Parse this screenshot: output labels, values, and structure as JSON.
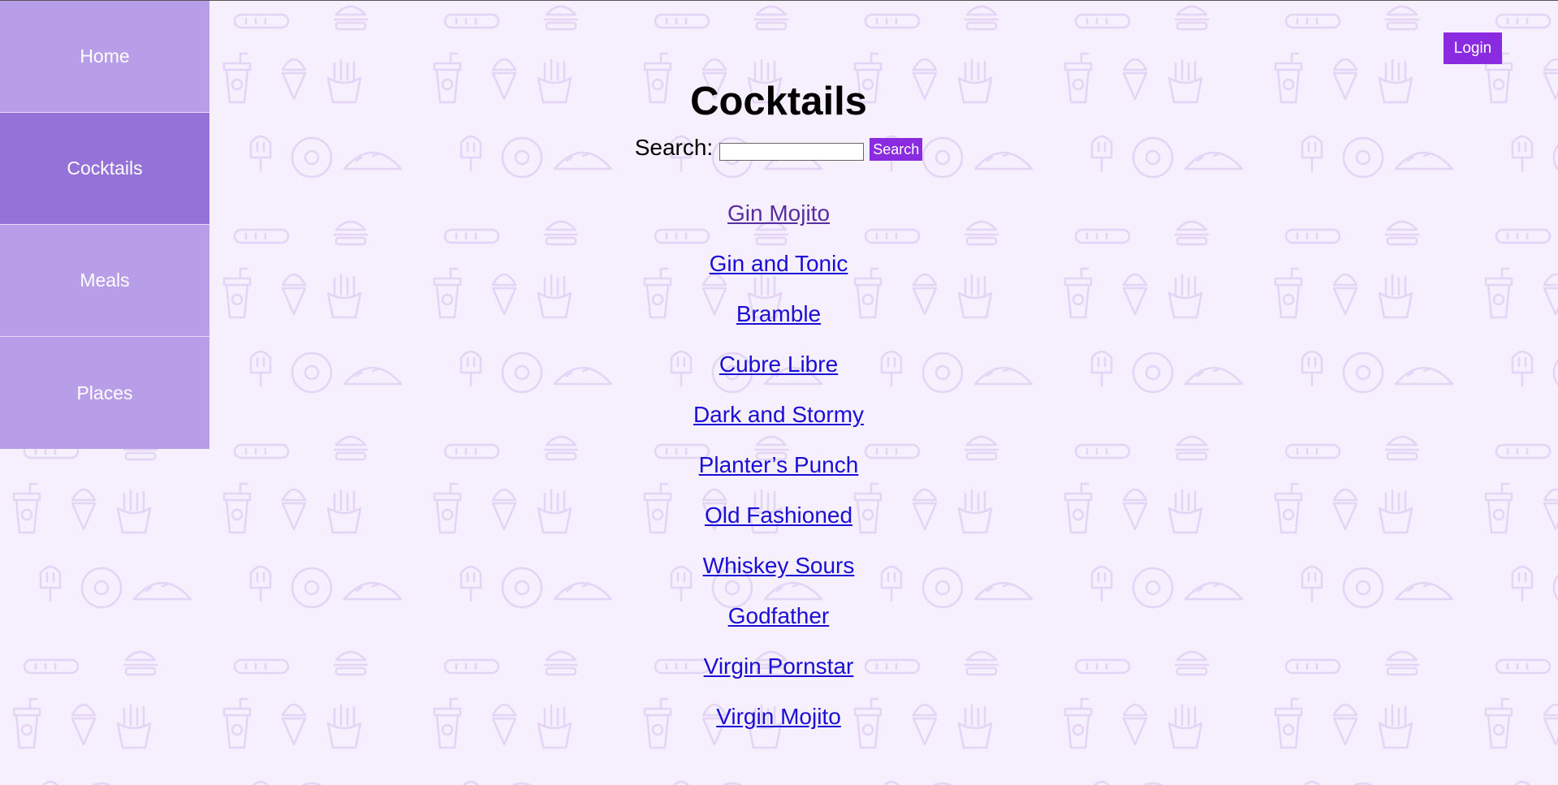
{
  "sidebar": {
    "items": [
      {
        "label": "Home",
        "active": false
      },
      {
        "label": "Cocktails",
        "active": true
      },
      {
        "label": "Meals",
        "active": false
      },
      {
        "label": "Places",
        "active": false
      }
    ]
  },
  "header": {
    "login_label": "Login"
  },
  "main": {
    "title": "Cocktails",
    "search": {
      "label": "Search:",
      "value": "",
      "button_label": "Search"
    },
    "cocktails": [
      "Gin Mojito",
      "Gin and Tonic",
      "Bramble",
      "Cubre Libre",
      "Dark and Stormy",
      "Planter’s Punch",
      "Old Fashioned",
      "Whiskey Sours",
      "Godfather",
      "Virgin Pornstar",
      "Virgin Mojito"
    ]
  },
  "colors": {
    "background": "#f6effd",
    "pattern_icon": "#e2d5f5",
    "nav": "#b89ee8",
    "nav_active": "#9472d8",
    "button": "#8a2be2",
    "link": "#1a0dd6",
    "link_visited": "#5a2d9e"
  },
  "icons": [
    "hotdog-icon",
    "burger-icon",
    "soda-cup-icon",
    "ice-cream-cone-icon",
    "fries-icon",
    "popsicle-icon",
    "donut-icon",
    "taco-icon"
  ]
}
